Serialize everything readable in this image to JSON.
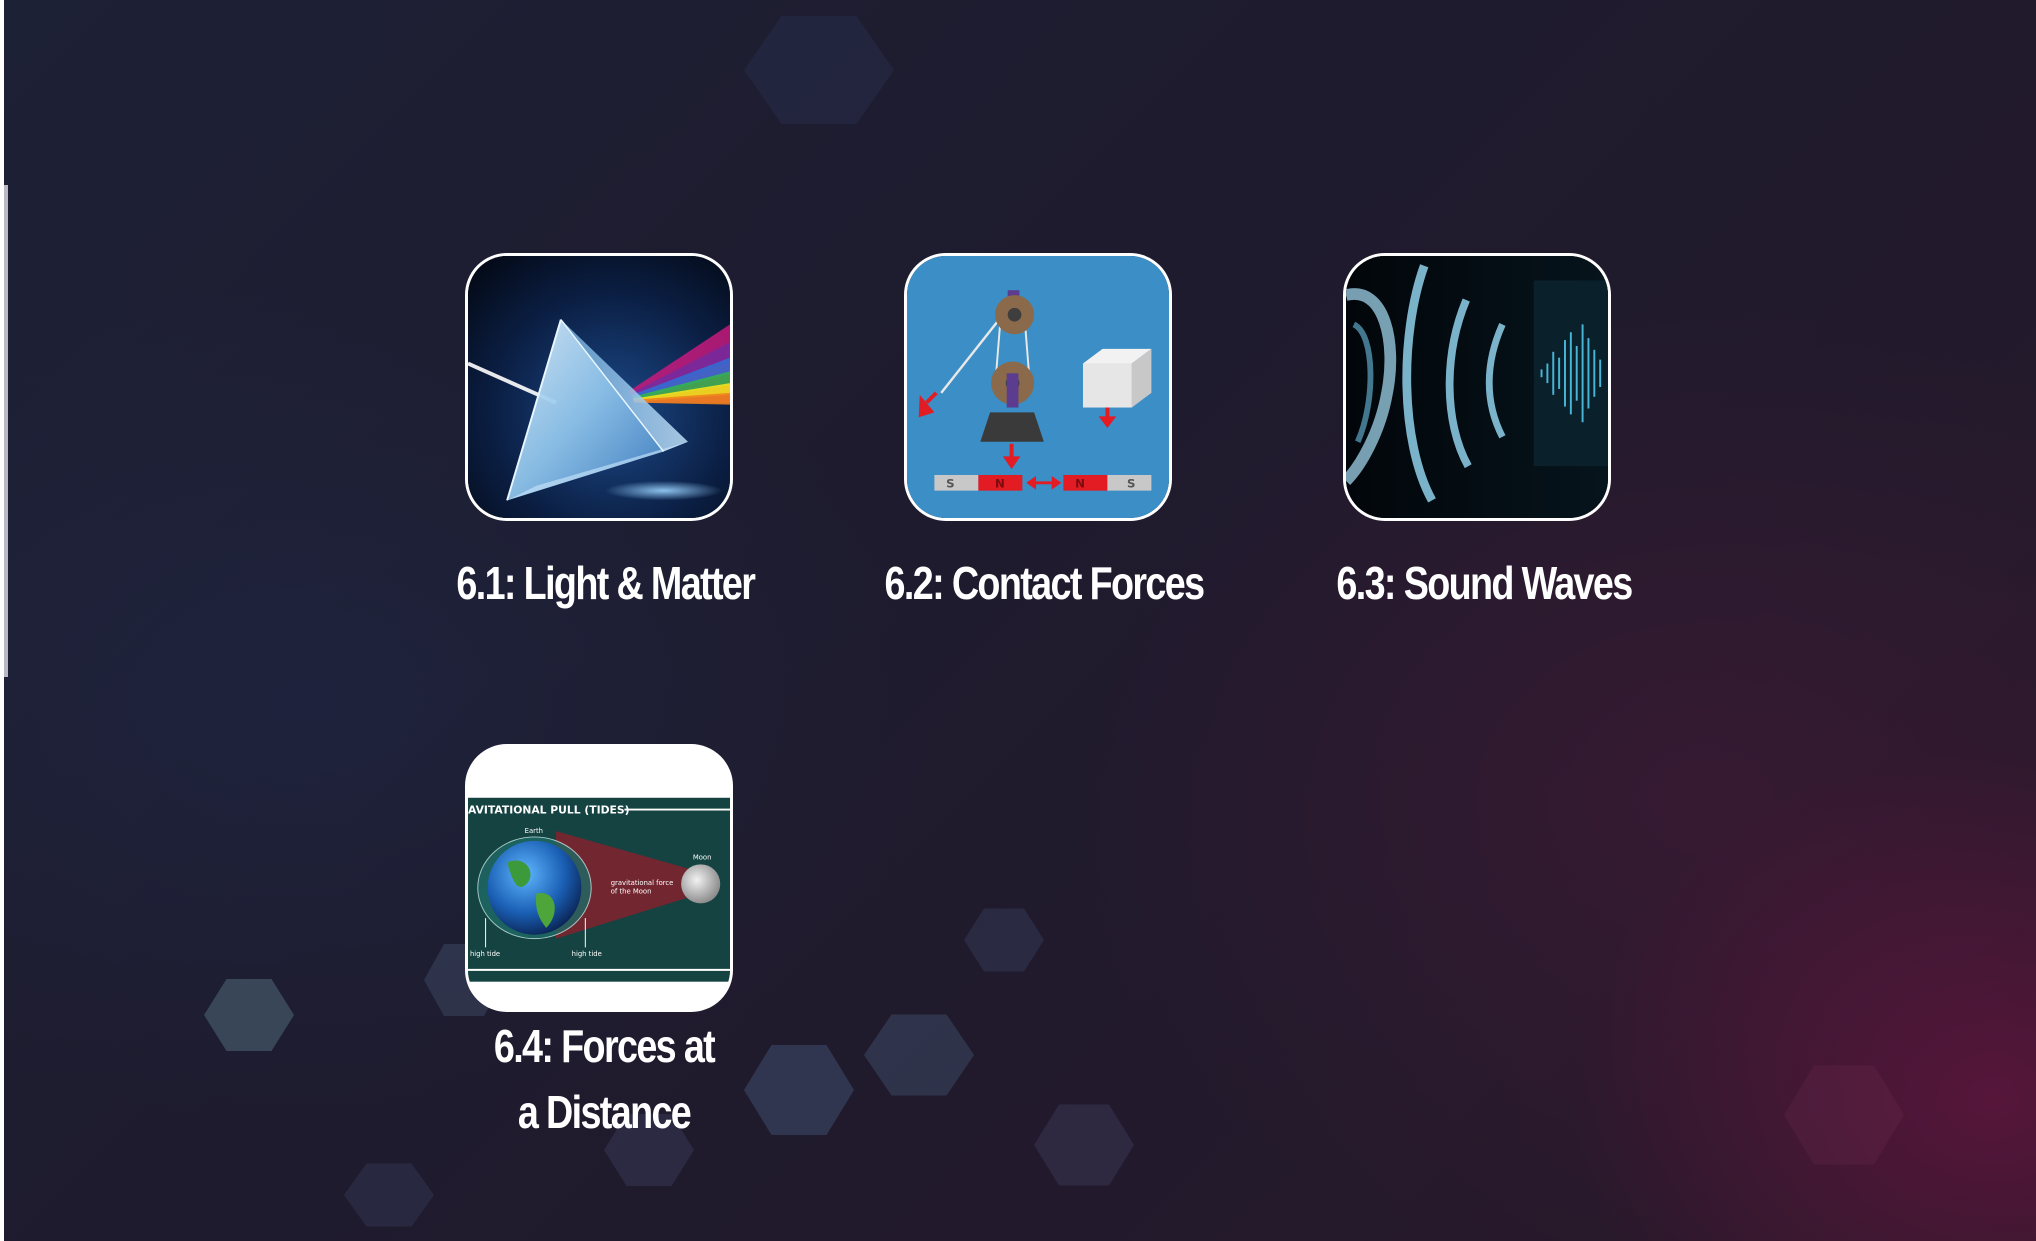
{
  "modules": [
    {
      "id": "6.1",
      "title": "6.1: Light & Matter",
      "icon": "prism-icon"
    },
    {
      "id": "6.2",
      "title": "6.2: Contact Forces",
      "icon": "pulley-magnets-icon",
      "thumbnail_text": {
        "magnet_left_s": "S",
        "magnet_left_n": "N",
        "magnet_right_n": "N",
        "magnet_right_s": "S"
      }
    },
    {
      "id": "6.3",
      "title": "6.3: Sound Waves",
      "icon": "ear-sound-waves-icon"
    },
    {
      "id": "6.4",
      "title_line1": "6.4: Forces at",
      "title_line2": "a Distance",
      "icon": "earth-moon-tides-icon",
      "thumbnail_text": {
        "heading": "AVITATIONAL PULL (TIDES)",
        "earth": "Earth",
        "moon": "Moon",
        "force_line1": "gravitational force",
        "force_line2": "of the Moon",
        "tide_left": "high tide",
        "tide_right": "high tide"
      }
    }
  ],
  "colors": {
    "label": "#ffffff",
    "tile_border": "#ffffff",
    "force_arrow": "#e31b23",
    "contact_bg": "#3b8ec6"
  }
}
